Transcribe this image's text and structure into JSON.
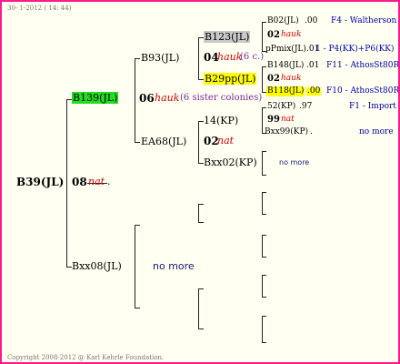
{
  "header": {
    "date": "30-  1-2012 ( 14: 44)"
  },
  "footer": {
    "copyright": "Copyright 2008-2012 @ Karl Kehrle Foundation."
  },
  "colors": {
    "border": "#ff1a8c",
    "green": "#22dd22",
    "yellow": "#ffff00",
    "gray": "#c8c8c8"
  },
  "root": {
    "name": "B39(JL)",
    "gen": "08",
    "tag": "nat",
    "dot": "."
  },
  "gen1": {
    "top": {
      "name": "B139(JL)",
      "gen": "06",
      "tag": "hauk",
      "note": "(6 sister colonies)"
    },
    "bottom": {
      "name": "Bxx08(JL)",
      "note": "no more"
    }
  },
  "gen2": {
    "b93": {
      "name": "B93(JL)",
      "gen": "04",
      "tag": "hauk",
      "note": "(6 c.)"
    },
    "ea68": {
      "name": "EA68(JL)",
      "gen": "02",
      "tag": "nat"
    }
  },
  "gen3": {
    "b123": {
      "name": "B123(JL)"
    },
    "b29pp": {
      "name": "B29pp(JL)"
    },
    "p14": {
      "name": "14(KP)",
      "gen": "99",
      "tag": "nat"
    },
    "bxx02": {
      "name": "Bxx02(KP)"
    }
  },
  "gen4": [
    {
      "name": "B02(JL)",
      "num": ".00",
      "origin": "F4 - Waltherson"
    },
    {
      "gen": "02",
      "tag": "hauk"
    },
    {
      "name": "pPmix(JL)",
      "num": ".01",
      "origin": "1 - P4(KK)+P6(KK)"
    },
    {
      "name": "B148(JL)",
      "num": ".01",
      "origin": "F11 - AthosSt80R"
    },
    {
      "gen": "02",
      "tag": "hauk"
    },
    {
      "name": "B118(JL)",
      "num": ".00",
      "origin": "F10 - AthosSt80R"
    },
    {
      "name": "52(KP)",
      "num": ".97",
      "origin": "F1 - Import"
    },
    {
      "gen": "99",
      "tag": "nat"
    },
    {
      "name": "Bxx99(KP)",
      "num": ".",
      "origin": "no more"
    },
    {
      "note": "no more"
    }
  ]
}
